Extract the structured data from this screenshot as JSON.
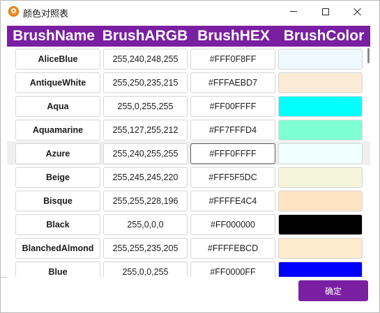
{
  "window": {
    "title": "颜色对照表"
  },
  "columns": [
    "BrushName",
    "BrushARGB",
    "BrushHEX",
    "BrushColor"
  ],
  "rows": [
    {
      "name": "AliceBlue",
      "argb": "255,240,248,255",
      "hex": "#FFF0F8FF",
      "color": "#F0F8FF"
    },
    {
      "name": "AntiqueWhite",
      "argb": "255,250,235,215",
      "hex": "#FFFAEBD7",
      "color": "#FAEBD7"
    },
    {
      "name": "Aqua",
      "argb": "255,0,255,255",
      "hex": "#FF00FFFF",
      "color": "#00FFFF"
    },
    {
      "name": "Aquamarine",
      "argb": "255,127,255,212",
      "hex": "#FF7FFFD4",
      "color": "#7FFFD4"
    },
    {
      "name": "Azure",
      "argb": "255,240,255,255",
      "hex": "#FFF0FFFF",
      "color": "#F0FFFF"
    },
    {
      "name": "Beige",
      "argb": "255,245,245,220",
      "hex": "#FFF5F5DC",
      "color": "#F5F5DC"
    },
    {
      "name": "Bisque",
      "argb": "255,255,228,196",
      "hex": "#FFFFE4C4",
      "color": "#FFE4C4"
    },
    {
      "name": "Black",
      "argb": "255,0,0,0",
      "hex": "#FF000000",
      "color": "#000000"
    },
    {
      "name": "BlanchedAlmond",
      "argb": "255,255,235,205",
      "hex": "#FFFFEBCD",
      "color": "#FFEBCD"
    },
    {
      "name": "Blue",
      "argb": "255,0,0,255",
      "hex": "#FF0000FF",
      "color": "#0000FF"
    }
  ],
  "selected_row": 4,
  "buttons": {
    "confirm": "确定"
  },
  "theme": {
    "accent": "#7A1FA2"
  }
}
